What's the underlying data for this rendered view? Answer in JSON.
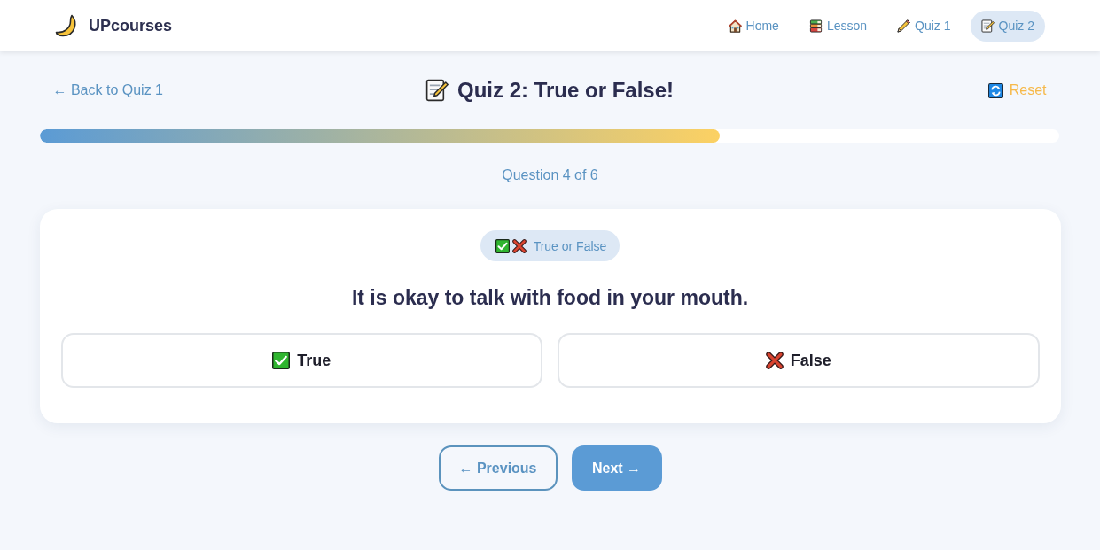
{
  "header": {
    "logo": "UPcourses",
    "nav": [
      {
        "label": "Home",
        "selected": false
      },
      {
        "label": "Lesson",
        "selected": false
      },
      {
        "label": "Quiz 1",
        "selected": false
      },
      {
        "label": "Quiz 2",
        "selected": true
      }
    ]
  },
  "toolbar": {
    "back_link": "← Back to Quiz 1",
    "title": "Quiz 2: True or False!",
    "reset": "Reset"
  },
  "progress": {
    "level": 0.667
  },
  "counter": "Question 4 of 6",
  "question": {
    "type_badge": "True or False",
    "text": "It is okay to talk with food in your mouth.",
    "options": [
      {
        "label": "True",
        "selected": false
      },
      {
        "label": "False",
        "selected": false
      }
    ]
  },
  "navigation": {
    "previous": "← Previous",
    "next": "Next →"
  }
}
